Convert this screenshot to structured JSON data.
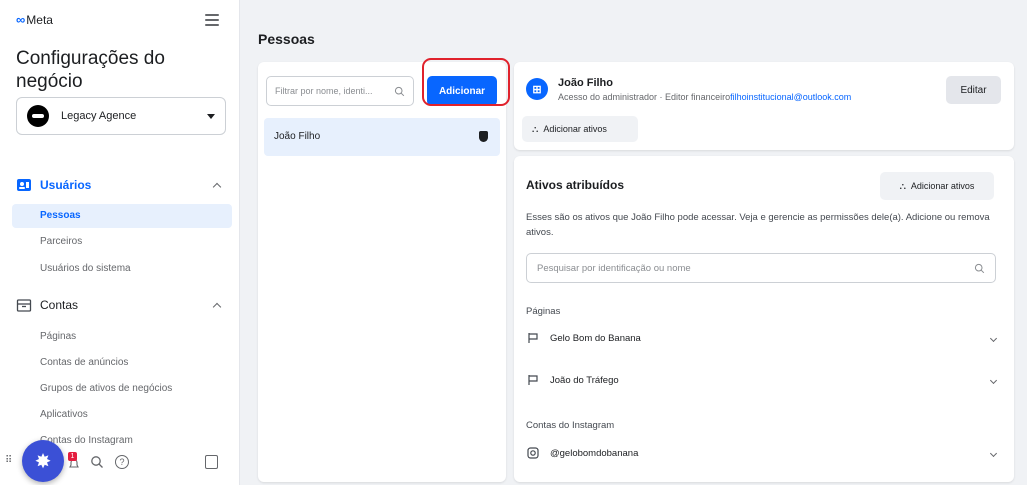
{
  "sidebar": {
    "brand": "Meta",
    "title": "Configurações do negócio",
    "account": "Legacy Agence",
    "users_section": {
      "label": "Usuários",
      "items": [
        "Pessoas",
        "Parceiros",
        "Usuários do sistema"
      ]
    },
    "accounts_section": {
      "label": "Contas",
      "items": [
        "Páginas",
        "Contas de anúncios",
        "Grupos de ativos de negócios",
        "Aplicativos",
        "Contas do Instagram"
      ]
    },
    "notification_count": "1"
  },
  "main": {
    "title": "Pessoas",
    "filter_placeholder": "Filtrar por nome, identi...",
    "add_button": "Adicionar",
    "people": [
      "João Filho"
    ]
  },
  "detail": {
    "name": "João Filho",
    "role_prefix": "Acesso do administrador · Editor financeiro",
    "email": "filhoinstitucional@outlook.com",
    "edit_button": "Editar",
    "add_assets_top": "Adicionar ativos",
    "assets_title": "Ativos atribuídos",
    "add_assets_button": "Adicionar ativos",
    "assets_description": "Esses são os ativos que João Filho pode acessar. Veja e gerencie as permissões dele(a). Adicione ou remova ativos.",
    "assets_search_placeholder": "Pesquisar por identificação ou nome",
    "pages_label": "Páginas",
    "pages": [
      "Gelo Bom do Banana",
      "João do Tráfego"
    ],
    "instagram_label": "Contas do Instagram",
    "instagram_accounts": [
      "@gelobomdobanana"
    ]
  },
  "colors": {
    "accent": "#0866ff",
    "highlight": "#e0222c",
    "fab": "#3b50d6"
  },
  "icons": [
    "menu-icon",
    "users-icon",
    "briefcase-icon",
    "shield-icon",
    "flag-icon",
    "instagram-icon",
    "search-icon",
    "help-icon",
    "bell-icon",
    "panel-icon",
    "gear-icon"
  ]
}
